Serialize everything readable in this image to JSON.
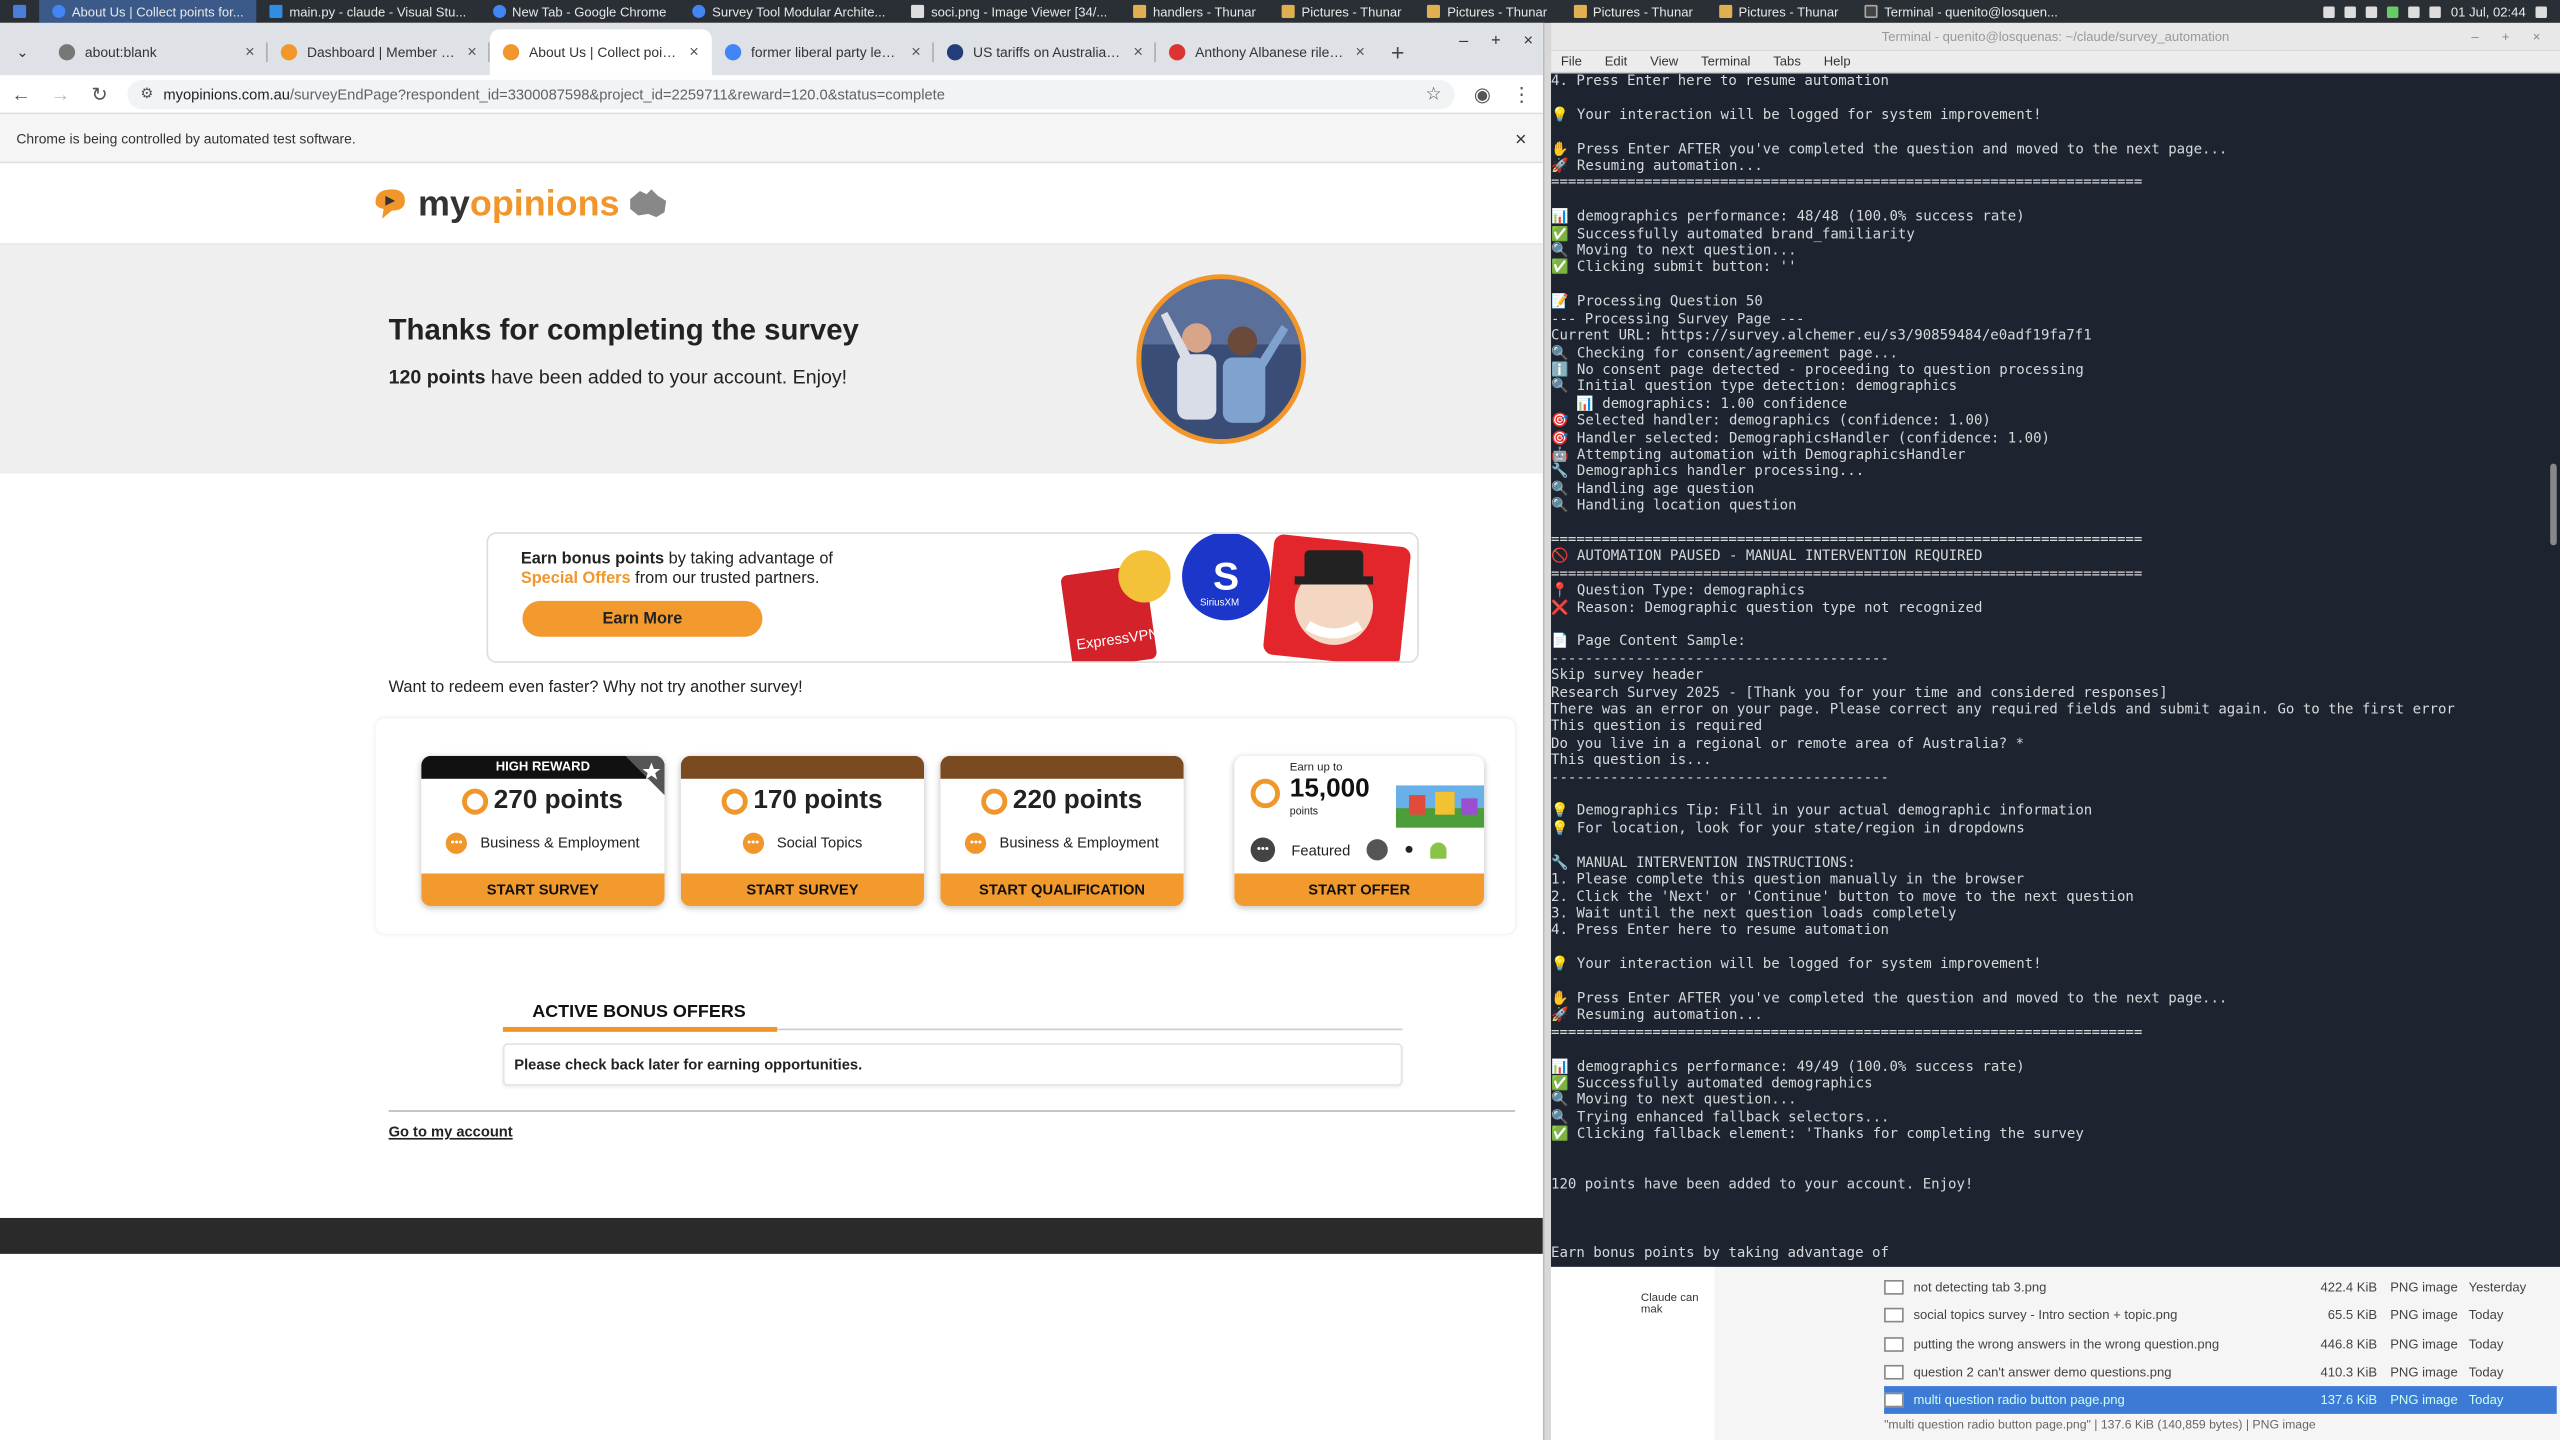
{
  "taskbar": {
    "items": [
      "About Us | Collect points for...",
      "main.py - claude - Visual Stu...",
      "New Tab - Google Chrome",
      "Survey Tool Modular Archite...",
      "soci.png - Image Viewer [34/...",
      "handlers - Thunar",
      "Pictures - Thunar",
      "Pictures - Thunar",
      "Pictures - Thunar",
      "Pictures - Thunar",
      "Terminal - quenito@losquen..."
    ],
    "clock": "01 Jul, 02:44"
  },
  "browser": {
    "tabs": [
      "about:blank",
      "Dashboard | Member | M",
      "About Us | Collect points f",
      "former liberal party leade",
      "US tariffs on Australia 'sho",
      "Anthony Albanese riled by"
    ],
    "url_host": "myopinions.com.au",
    "url_path": "/surveyEndPage?respondent_id=3300087598&project_id=2259711&reward=120.0&status=complete",
    "infobar": "Chrome is being controlled by automated test software."
  },
  "site": {
    "logo_my": "my",
    "logo_opinions": "opinions",
    "hero_title": "Thanks for completing the survey",
    "hero_points": "120 points",
    "hero_rest": " have been added to your account. Enjoy!",
    "bonus_line1_bold": "Earn bonus points",
    "bonus_line1_rest": " by taking advantage of",
    "bonus_special": "Special Offers",
    "bonus_line2_rest": " from our trusted partners.",
    "earn_more": "Earn More",
    "partner_labels": [
      "ExpressVPN",
      "SiriusXM"
    ],
    "redeem_text": "Want to redeem even faster? Why not try another survey!",
    "cards": [
      {
        "band": "HIGH REWARD",
        "points": "270 points",
        "category": "Business & Employment",
        "button": "START SURVEY"
      },
      {
        "band": "",
        "points": "170 points",
        "category": "Social Topics",
        "button": "START SURVEY"
      },
      {
        "band": "",
        "points": "220 points",
        "category": "Business & Employment",
        "button": "START QUALIFICATION"
      }
    ],
    "offer": {
      "upto": "Earn up to",
      "amount": "15,000",
      "unit": "points",
      "featured": "Featured",
      "button": "START OFFER"
    },
    "active_title": "ACTIVE BONUS OFFERS",
    "active_msg": "Please check back later for earning opportunities.",
    "go_account": "Go to my account"
  },
  "terminal": {
    "title": "Terminal - quenito@losquenas: ~/claude/survey_automation",
    "menu": [
      "File",
      "Edit",
      "View",
      "Terminal",
      "Tabs",
      "Help"
    ],
    "lines": [
      "4. Press Enter here to resume automation",
      "",
      "💡 Your interaction will be logged for system improvement!",
      "",
      "✋ Press Enter AFTER you've completed the question and moved to the next page...",
      "🚀 Resuming automation...",
      "======================================================================",
      "",
      "📊 demographics performance: 48/48 (100.0% success rate)",
      "✅ Successfully automated brand_familiarity",
      "🔍 Moving to next question...",
      "✅ Clicking submit button: ''",
      "",
      "📝 Processing Question 50",
      "--- Processing Survey Page ---",
      "Current URL: https://survey.alchemer.eu/s3/90859484/e0adf19fa7f1",
      "🔍 Checking for consent/agreement page...",
      "ℹ️ No consent page detected - proceeding to question processing",
      "🔍 Initial question type detection: demographics",
      "   📊 demographics: 1.00 confidence",
      "🎯 Selected handler: demographics (confidence: 1.00)",
      "🎯 Handler selected: DemographicsHandler (confidence: 1.00)",
      "🤖 Attempting automation with DemographicsHandler",
      "🔧 Demographics handler processing...",
      "🔍 Handling age question",
      "🔍 Handling location question",
      "",
      "======================================================================",
      "🚫 AUTOMATION PAUSED - MANUAL INTERVENTION REQUIRED",
      "======================================================================",
      "📍 Question Type: demographics",
      "❌ Reason: Demographic question type not recognized",
      "",
      "📄 Page Content Sample:",
      "----------------------------------------",
      "Skip survey header",
      "Research Survey 2025 - [Thank you for your time and considered responses]",
      "There was an error on your page. Please correct any required fields and submit again. Go to the first error",
      "This question is required",
      "Do you live in a regional or remote area of Australia? *",
      "This question is...",
      "----------------------------------------",
      "",
      "💡 Demographics Tip: Fill in your actual demographic information",
      "💡 For location, look for your state/region in dropdowns",
      "",
      "🔧 MANUAL INTERVENTION INSTRUCTIONS:",
      "1. Please complete this question manually in the browser",
      "2. Click the 'Next' or 'Continue' button to move to the next question",
      "3. Wait until the next question loads completely",
      "4. Press Enter here to resume automation",
      "",
      "💡 Your interaction will be logged for system improvement!",
      "",
      "✋ Press Enter AFTER you've completed the question and moved to the next page...",
      "🚀 Resuming automation...",
      "======================================================================",
      "",
      "📊 demographics performance: 49/49 (100.0% success rate)",
      "✅ Successfully automated demographics",
      "🔍 Moving to next question...",
      "🔍 Trying enhanced fallback selectors...",
      "✅ Clicking fallback element: 'Thanks for completing the survey",
      "",
      "",
      "120 points have been added to your account. Enjoy!",
      "",
      "",
      "",
      "Earn bonus points by taking advantage of"
    ]
  },
  "filemanager": {
    "left_text": "Claude can mak",
    "rows": [
      {
        "name": "not detecting tab 3.png",
        "size": "422.4 KiB",
        "type": "PNG image",
        "date": "Yesterday"
      },
      {
        "name": "social topics survey - Intro section + topic.png",
        "size": "65.5 KiB",
        "type": "PNG image",
        "date": "Today"
      },
      {
        "name": "putting the wrong answers in the wrong question.png",
        "size": "446.8 KiB",
        "type": "PNG image",
        "date": "Today"
      },
      {
        "name": "question 2 can't answer demo questions.png",
        "size": "410.3 KiB",
        "type": "PNG image",
        "date": "Today"
      },
      {
        "name": "multi question radio button page.png",
        "size": "137.6 KiB",
        "type": "PNG image",
        "date": "Today"
      }
    ],
    "status": "\"multi question radio button page.png\" | 137.6 KiB (140,859 bytes) | PNG image"
  },
  "colors": {
    "accent": "#f0962b",
    "terminal_bg": "#1d2430",
    "footer": "#2a2a2a"
  }
}
